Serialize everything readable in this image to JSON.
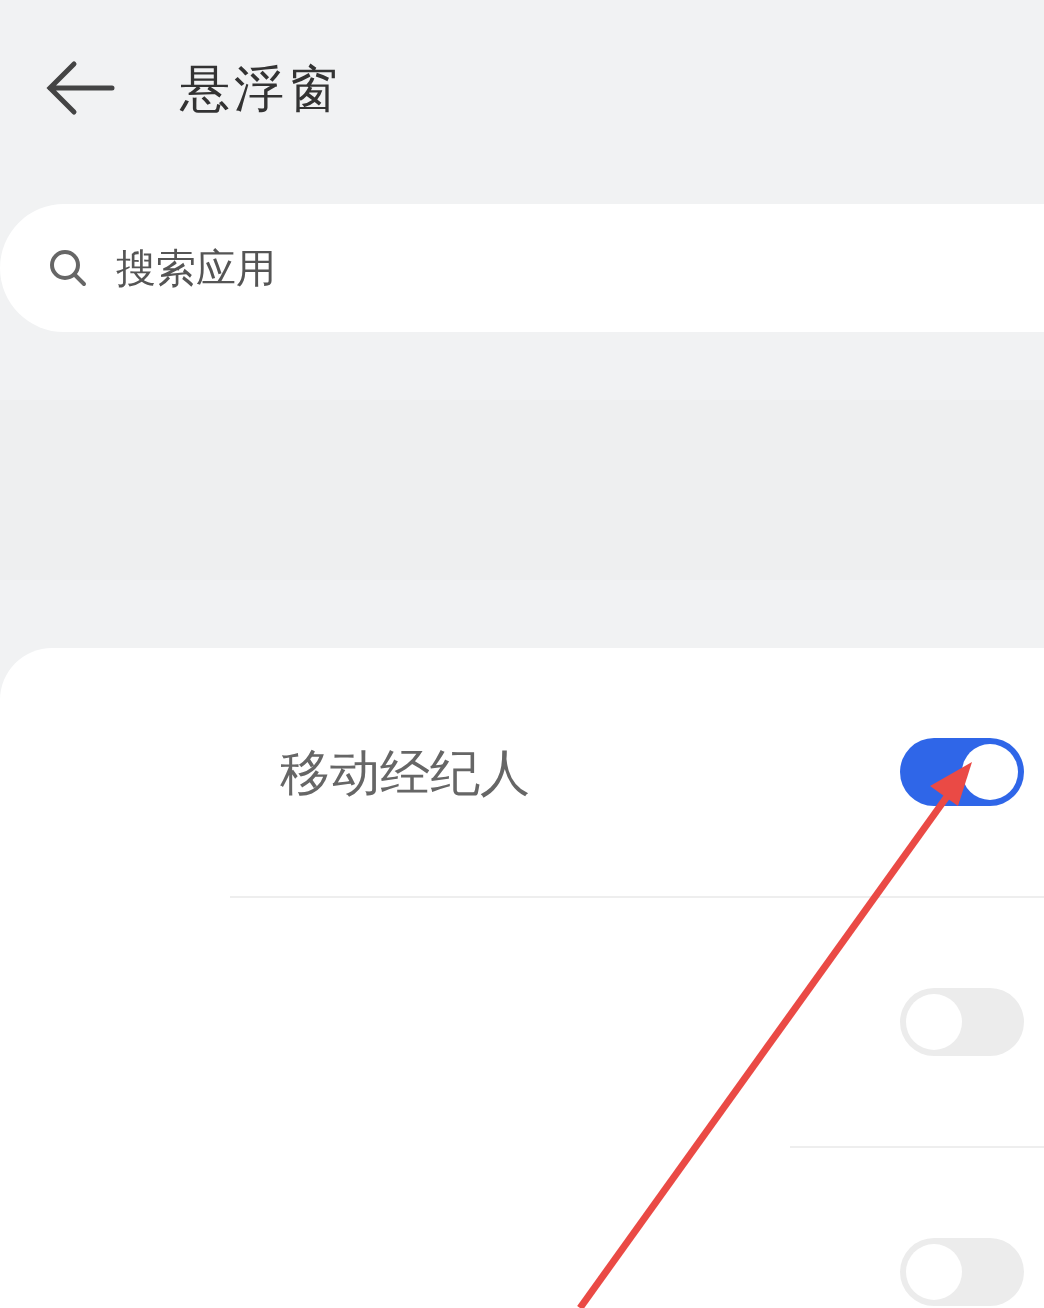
{
  "header": {
    "title": "悬浮窗"
  },
  "search": {
    "placeholder": "搜索应用"
  },
  "apps": [
    {
      "name": "移动经纪人",
      "on": true
    },
    {
      "on": false
    },
    {
      "on": false
    }
  ]
}
